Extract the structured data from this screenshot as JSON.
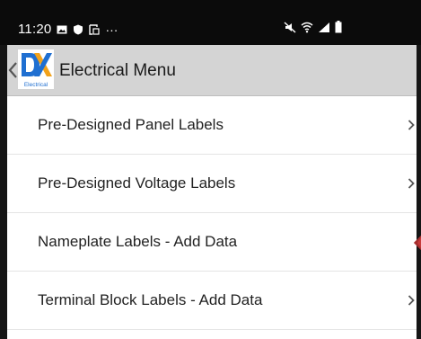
{
  "status_bar": {
    "time": "11:20",
    "more": "···",
    "icons_left": [
      "gallery-icon",
      "shield-icon",
      "screenshot-icon"
    ],
    "icons_right": [
      "mute-icon",
      "wifi-icon",
      "signal-icon",
      "battery-icon"
    ]
  },
  "header": {
    "title": "Electrical Menu",
    "logo_text": "Electrical",
    "logo_colors": {
      "blue": "#1f6fd1",
      "orange": "#f2a21b"
    }
  },
  "menu": {
    "items": [
      {
        "label": "Pre-Designed Panel Labels",
        "trailing": "chevron"
      },
      {
        "label": "Pre-Designed Voltage Labels",
        "trailing": "chevron"
      },
      {
        "label": "Nameplate Labels - Add Data",
        "trailing": "red-tab"
      },
      {
        "label": "Terminal Block Labels - Add Data",
        "trailing": "chevron"
      }
    ]
  },
  "colors": {
    "header_bg": "#d4d4d4",
    "status_bg": "#0b0b0b",
    "divider": "#e4e4e4",
    "accent_red": "#c63b3b"
  }
}
